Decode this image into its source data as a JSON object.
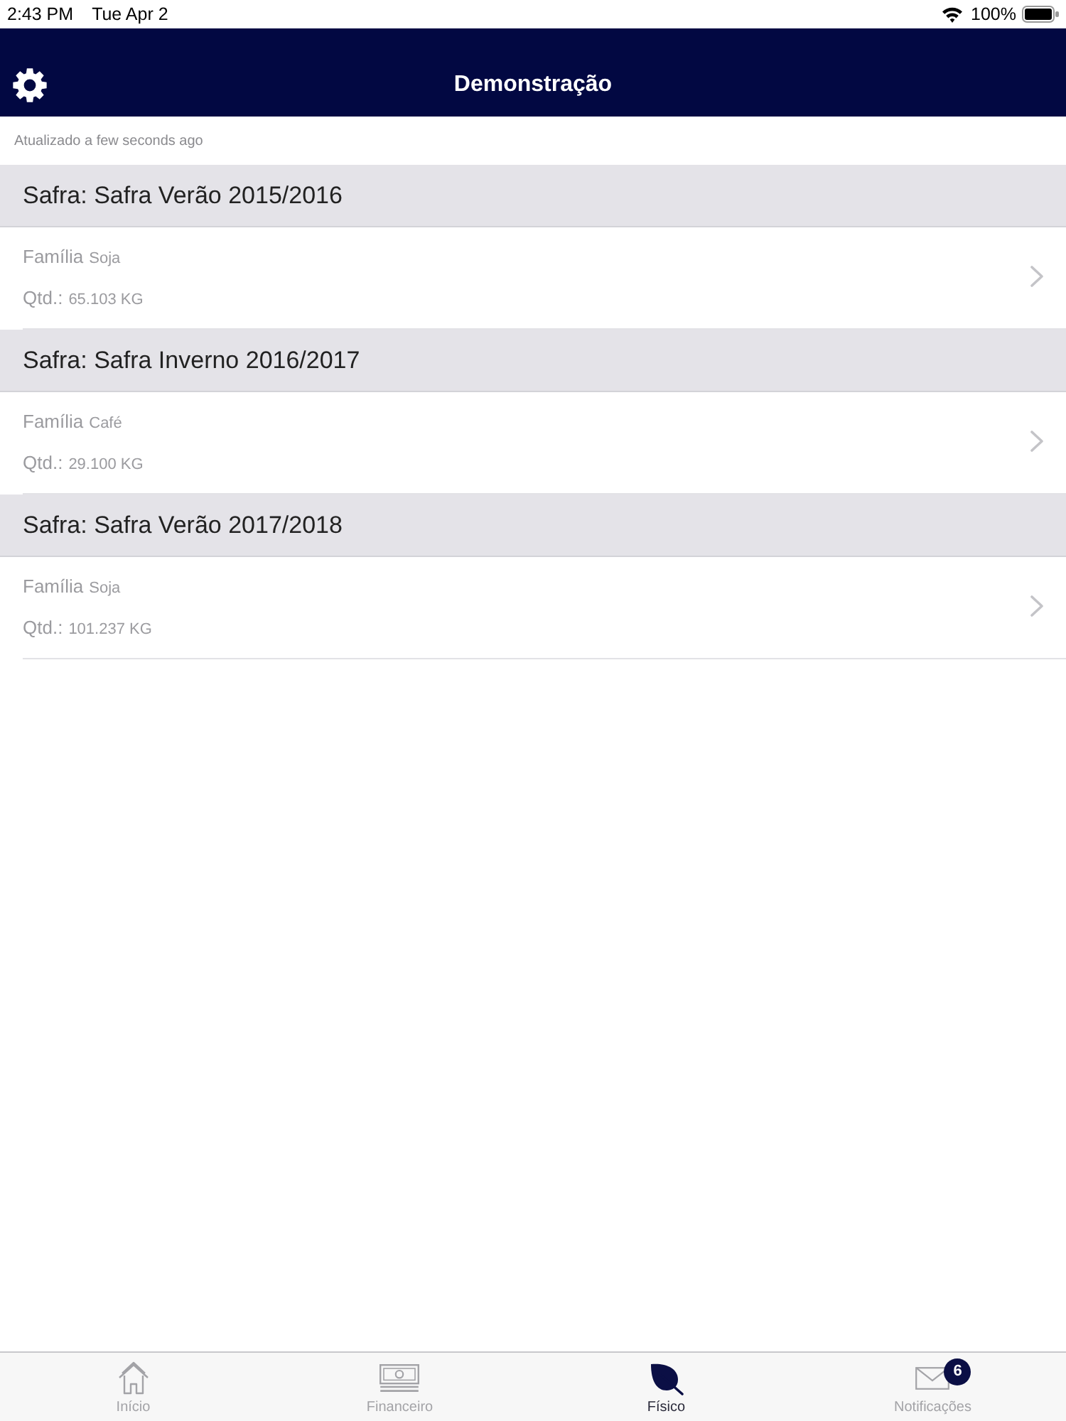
{
  "status_bar": {
    "time": "2:43 PM",
    "date": "Tue Apr 2",
    "battery": "100%"
  },
  "nav_bar": {
    "title": "Demonstração"
  },
  "updated_label": "Atualizado a few seconds ago",
  "sections": [
    {
      "header": "Safra: Safra Verão 2015/2016",
      "rows": [
        {
          "family_label": "Família",
          "family": "Soja",
          "qty_label": "Qtd.:",
          "qty": "65.103 KG"
        }
      ]
    },
    {
      "header": "Safra: Safra Inverno 2016/2017",
      "rows": [
        {
          "family_label": "Família",
          "family": "Café",
          "qty_label": "Qtd.:",
          "qty": "29.100 KG"
        }
      ]
    },
    {
      "header": "Safra: Safra Verão 2017/2018",
      "rows": [
        {
          "family_label": "Família",
          "family": "Soja",
          "qty_label": "Qtd.:",
          "qty": "101.237 KG"
        }
      ]
    }
  ],
  "tab_bar": {
    "tabs": [
      {
        "kind": "home",
        "label": "Início",
        "selected": false
      },
      {
        "kind": "money",
        "label": "Financeiro",
        "selected": false
      },
      {
        "kind": "leaf",
        "label": "Físico",
        "selected": true
      },
      {
        "kind": "mail",
        "label": "Notificações",
        "selected": false,
        "badge": "6"
      }
    ]
  }
}
